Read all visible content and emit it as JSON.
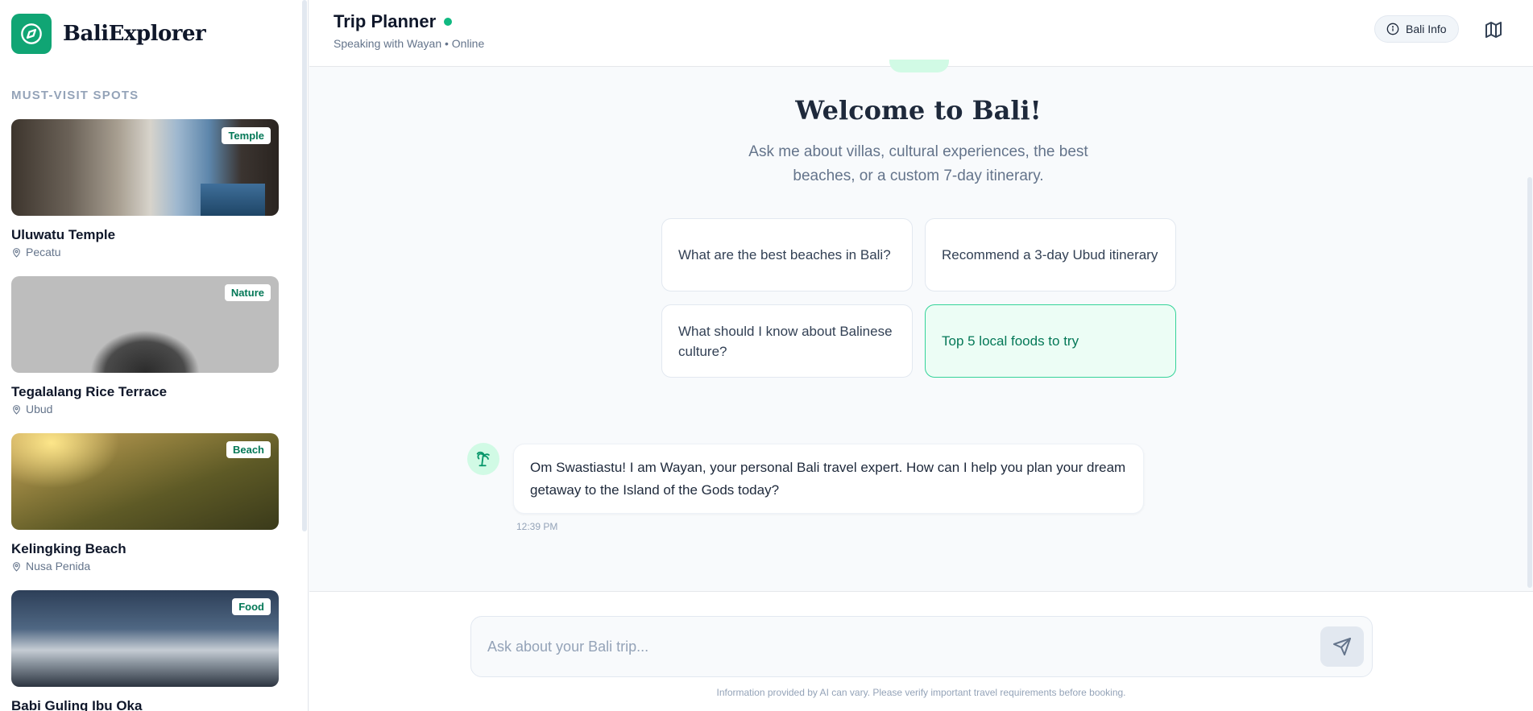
{
  "app": {
    "name": "BaliExplorer",
    "accent": "#10a574"
  },
  "sidebar": {
    "section_title": "MUST-VISIT SPOTS",
    "spots": [
      {
        "name": "Uluwatu Temple",
        "location": "Pecatu",
        "tag": "Temple"
      },
      {
        "name": "Tegalalang Rice Terrace",
        "location": "Ubud",
        "tag": "Nature"
      },
      {
        "name": "Kelingking Beach",
        "location": "Nusa Penida",
        "tag": "Beach"
      },
      {
        "name": "Babi Guling Ibu Oka",
        "location": "",
        "tag": "Food"
      }
    ]
  },
  "header": {
    "title": "Trip Planner",
    "subtitle": "Speaking with Wayan • Online",
    "status_color": "#10b981",
    "info_button": "Bali Info",
    "map_icon": "map-icon"
  },
  "welcome": {
    "title": "Welcome to Bali!",
    "subtitle": "Ask me about villas, cultural experiences, the best beaches, or a custom 7-day itinerary."
  },
  "suggestions": [
    "What are the best beaches in Bali?",
    "Recommend a 3-day Ubud itinerary",
    "What should I know about Balinese culture?",
    "Top 5 local foods to try"
  ],
  "messages": [
    {
      "sender": "bot",
      "avatar_icon": "palm-tree-icon",
      "text": "Om Swastiastu! I am Wayan, your personal Bali travel expert. How can I help you plan your dream getaway to the Island of the Gods today?",
      "time": "12:39 PM"
    }
  ],
  "composer": {
    "placeholder": "Ask about your Bali trip...",
    "value": "",
    "send_icon": "send-icon"
  },
  "disclaimer": "Information provided by AI can vary. Please verify important travel requirements before booking."
}
